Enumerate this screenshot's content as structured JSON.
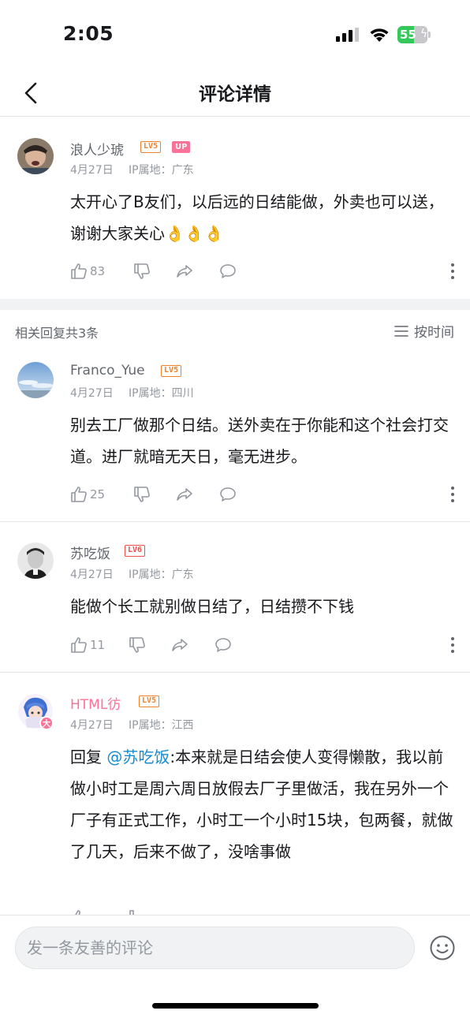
{
  "status": {
    "time": "2:05",
    "battery": "55",
    "battery_level": 0.55
  },
  "nav": {
    "title": "评论详情"
  },
  "main_comment": {
    "username": "浪人少琥",
    "level": "LV5",
    "badge": "UP",
    "date": "4月27日",
    "ip": "IP属地：广东",
    "text": "太开心了B友们，以后远的日结能做，外卖也可以送，谢谢大家关心",
    "emoji": "👌👌👌",
    "likes": "83"
  },
  "replies_header": {
    "count_label": "相关回复共3条",
    "sort_label": "按时间"
  },
  "replies": [
    {
      "username": "Franco_Yue",
      "level": "LV5",
      "date": "4月27日",
      "ip": "IP属地：四川",
      "text": "别去工厂做那个日结。送外卖在于你能和这个社会打交道。进厂就暗无天日，毫无进步。",
      "likes": "25"
    },
    {
      "username": "苏吃饭",
      "level": "LV6",
      "date": "4月27日",
      "ip": "IP属地：广东",
      "text": "能做个长工就别做日结了，日结攒不下钱",
      "likes": "11"
    },
    {
      "username": "HTML彷",
      "level": "LV5",
      "date": "4月27日",
      "ip": "IP属地：江西",
      "reply_prefix": "回复",
      "mention": "@苏吃饭",
      "text": ":本来就是日结会使人变得懒散，我以前做小时工是周六周日放假去厂子里做活，我在另外一个厂子有正式工作，小时工一个小时15块，包两餐，就做了几天，后来不做了，没啥事做"
    }
  ],
  "input": {
    "placeholder": "发一条友善的评论"
  },
  "colors": {
    "accent_pink": "#fb7299",
    "level_orange": "#f0812d",
    "level_red": "#f04c49",
    "mention_blue": "#178bcf"
  }
}
